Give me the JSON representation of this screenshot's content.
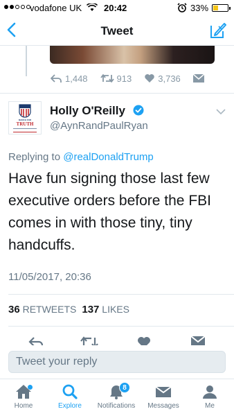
{
  "status_bar": {
    "carrier": "vodafone UK",
    "time": "20:42",
    "battery_percent": "33%",
    "battery_level": 0.33,
    "signal_bars": 2,
    "icons": [
      "signal-icon",
      "wifi-icon",
      "alarm-icon",
      "battery-icon"
    ]
  },
  "nav": {
    "title": "Tweet",
    "back_icon": "chevron-left-icon",
    "compose_icon": "compose-tweet-icon"
  },
  "previous_tweet": {
    "replies": "1,448",
    "retweets": "913",
    "likes": "3,736"
  },
  "tweet": {
    "author_name": "Holly O'Reilly",
    "author_handle": "@AynRandPaulRyan",
    "verified": true,
    "avatar_text": {
      "line1": "MARCH FOR",
      "line2": "TRUTH"
    },
    "replying_prefix": "Replying to",
    "replying_to": "@realDonaldTrump",
    "text": "Have fun signing those last few executive orders before the FBI comes in with those tiny, tiny handcuffs.",
    "timestamp": "11/05/2017, 20:36",
    "retweet_count": "36",
    "retweet_label": "RETWEETS",
    "like_count": "137",
    "like_label": "LIKES"
  },
  "reply_box": {
    "placeholder": "Tweet your reply"
  },
  "tab_bar": {
    "items": [
      {
        "label": "Home",
        "icon": "home-icon"
      },
      {
        "label": "Explore",
        "icon": "search-icon"
      },
      {
        "label": "Notifications",
        "icon": "bell-icon",
        "badge": "8"
      },
      {
        "label": "Messages",
        "icon": "envelope-icon"
      },
      {
        "label": "Me",
        "icon": "person-icon"
      }
    ],
    "active": "Explore"
  },
  "colors": {
    "accent": "#1da1f2",
    "text": "#14171a",
    "muted": "#657786",
    "icon_gray": "#8899a6",
    "battery_fill": "#f5c518"
  }
}
